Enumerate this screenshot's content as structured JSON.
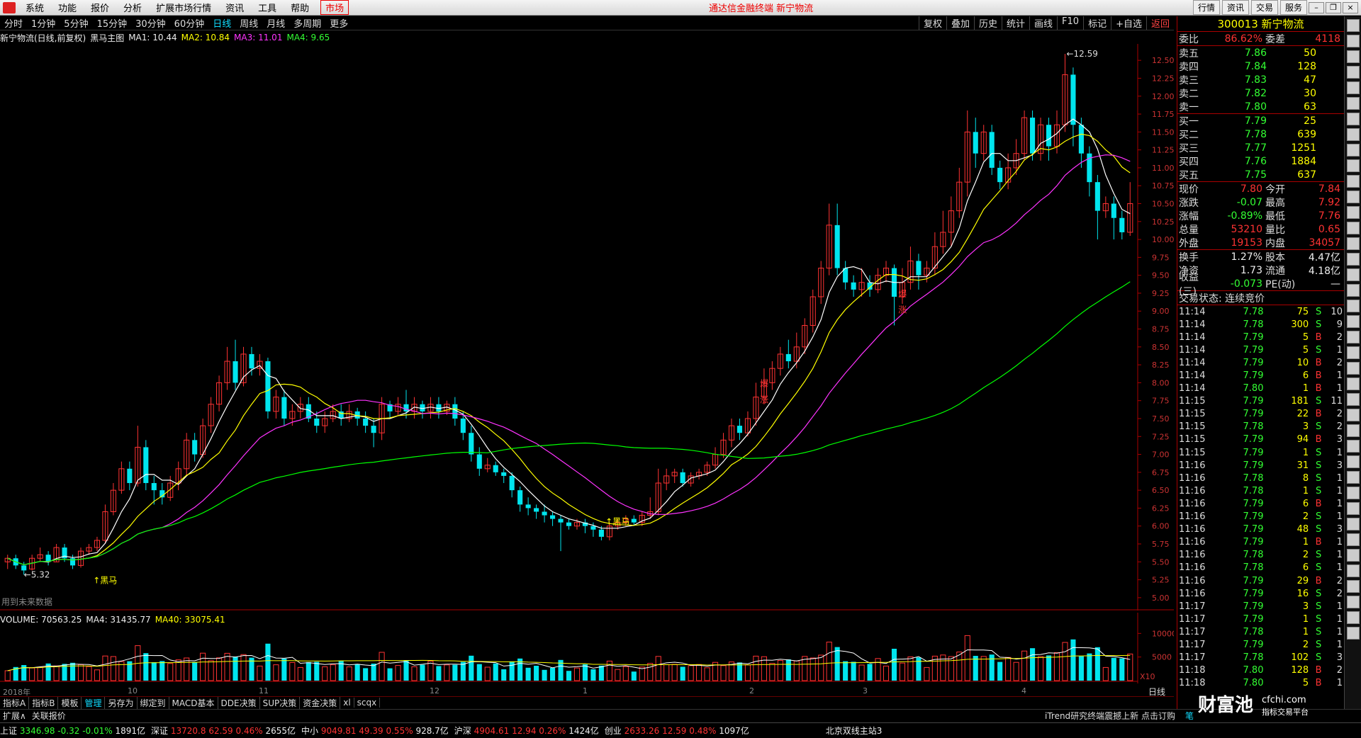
{
  "menu": {
    "items": [
      "系统",
      "功能",
      "报价",
      "分析",
      "扩展市场行情",
      "资讯",
      "工具",
      "帮助"
    ],
    "market": "市场",
    "center_title": "通达信金融终端  新宁物流",
    "right_buttons": [
      "行情",
      "资讯",
      "交易",
      "服务"
    ]
  },
  "periods": {
    "tabs": [
      "分时",
      "1分钟",
      "5分钟",
      "15分钟",
      "30分钟",
      "60分钟",
      "日线",
      "周线",
      "月线",
      "多周期",
      "更多"
    ],
    "active": "日线",
    "tools": [
      "复权",
      "叠加",
      "历史",
      "统计",
      "画线",
      "F10",
      "标记",
      "+自选",
      "返回"
    ]
  },
  "title_row": {
    "stock": "新宁物流(日线,前复权)",
    "indicator": "黑马主图",
    "ma1": "MA1: 10.44",
    "ma2": "MA2: 10.84",
    "ma3": "MA3: 11.01",
    "ma4": "MA4: 9.65"
  },
  "main_labels": {
    "high_label": "12.59",
    "low_label": "5.32",
    "heima1": "黑马",
    "heima2": "黑马",
    "future_data": "用到未来数据",
    "burst1": "爆",
    "burst2": "涨",
    "burst3": "爆",
    "burst4": "涨"
  },
  "colors": {
    "up": "#ff3333",
    "down": "#00e5ee",
    "ma1": "#ffffff",
    "ma2": "#ffff00",
    "ma3": "#ff33ff",
    "ma4": "#00ff00",
    "axis": "#aa0000"
  },
  "volume_row": {
    "volume": "VOLUME: 70563.25",
    "ma4": "MA4: 31435.77",
    "ma40": "MA40: 33075.41"
  },
  "price_axis": [
    "12.50",
    "12.25",
    "12.00",
    "11.75",
    "11.50",
    "11.25",
    "11.00",
    "10.75",
    "10.50",
    "10.25",
    "10.00",
    "9.75",
    "9.50",
    "9.25",
    "9.00",
    "8.75",
    "8.50",
    "8.25",
    "8.00",
    "7.75",
    "7.50",
    "7.25",
    "7.00",
    "6.75",
    "6.50",
    "6.25",
    "6.00",
    "5.75",
    "5.50",
    "5.25",
    "5.00"
  ],
  "vol_axis": [
    "10000",
    "5000",
    "X10"
  ],
  "x_dates": [
    "2018年",
    "10",
    "11",
    "12",
    "1",
    "2",
    "3",
    "4"
  ],
  "chart_data": {
    "type": "candlestick",
    "ylim": [
      5.0,
      12.59
    ],
    "candles": [
      [
        5.5,
        5.55,
        5.4,
        5.6
      ],
      [
        5.55,
        5.45,
        5.4,
        5.6
      ],
      [
        5.45,
        5.38,
        5.32,
        5.5
      ],
      [
        5.4,
        5.55,
        5.38,
        5.6
      ],
      [
        5.55,
        5.6,
        5.5,
        5.7
      ],
      [
        5.6,
        5.5,
        5.45,
        5.65
      ],
      [
        5.5,
        5.7,
        5.5,
        5.75
      ],
      [
        5.7,
        5.55,
        5.5,
        5.75
      ],
      [
        5.55,
        5.45,
        5.4,
        5.6
      ],
      [
        5.45,
        5.65,
        5.42,
        5.7
      ],
      [
        5.65,
        5.7,
        5.6,
        5.75
      ],
      [
        5.7,
        5.8,
        5.65,
        5.85
      ],
      [
        5.8,
        6.2,
        5.75,
        6.3
      ],
      [
        6.2,
        6.5,
        6.15,
        6.6
      ],
      [
        6.5,
        6.8,
        6.45,
        6.9
      ],
      [
        6.8,
        6.6,
        6.5,
        6.9
      ],
      [
        6.6,
        7.1,
        6.55,
        7.4
      ],
      [
        7.1,
        6.6,
        6.5,
        7.2
      ],
      [
        6.6,
        6.5,
        6.3,
        6.7
      ],
      [
        6.5,
        6.4,
        6.3,
        6.6
      ],
      [
        6.4,
        6.6,
        6.35,
        6.7
      ],
      [
        6.6,
        6.8,
        6.5,
        6.9
      ],
      [
        6.8,
        7.2,
        6.7,
        7.3
      ],
      [
        7.2,
        7.0,
        6.9,
        7.3
      ],
      [
        7.0,
        7.4,
        6.95,
        7.5
      ],
      [
        7.4,
        7.7,
        7.3,
        7.8
      ],
      [
        7.7,
        8.0,
        7.6,
        8.1
      ],
      [
        8.0,
        8.3,
        7.9,
        8.5
      ],
      [
        8.3,
        8.0,
        7.9,
        8.6
      ],
      [
        8.0,
        8.4,
        7.95,
        8.5
      ],
      [
        8.4,
        8.2,
        8.1,
        8.5
      ],
      [
        8.2,
        8.3,
        8.1,
        8.4
      ],
      [
        8.3,
        7.6,
        7.5,
        8.35
      ],
      [
        7.6,
        7.8,
        7.5,
        7.9
      ],
      [
        7.8,
        7.5,
        7.4,
        7.9
      ],
      [
        7.5,
        7.6,
        7.4,
        7.7
      ],
      [
        7.6,
        7.7,
        7.5,
        7.8
      ],
      [
        7.7,
        7.5,
        7.45,
        7.8
      ],
      [
        7.5,
        7.4,
        7.3,
        7.6
      ],
      [
        7.4,
        7.5,
        7.3,
        7.6
      ],
      [
        7.5,
        7.6,
        7.45,
        7.7
      ],
      [
        7.6,
        7.5,
        7.4,
        7.7
      ],
      [
        7.5,
        7.6,
        7.45,
        7.7
      ],
      [
        7.6,
        7.5,
        7.4,
        7.65
      ],
      [
        7.5,
        7.4,
        7.3,
        7.6
      ],
      [
        7.4,
        7.3,
        7.1,
        7.5
      ],
      [
        7.3,
        7.7,
        7.2,
        7.8
      ],
      [
        7.7,
        7.6,
        7.5,
        7.75
      ],
      [
        7.6,
        7.7,
        7.55,
        7.8
      ],
      [
        7.7,
        7.6,
        7.5,
        7.9
      ],
      [
        7.6,
        7.7,
        7.5,
        7.8
      ],
      [
        7.7,
        7.6,
        7.5,
        7.75
      ],
      [
        7.6,
        7.7,
        7.5,
        7.8
      ],
      [
        7.7,
        7.6,
        7.5,
        7.8
      ],
      [
        7.6,
        7.7,
        7.55,
        7.75
      ],
      [
        7.7,
        7.5,
        7.4,
        7.8
      ],
      [
        7.5,
        7.3,
        7.2,
        7.6
      ],
      [
        7.3,
        7.0,
        6.9,
        7.4
      ],
      [
        7.0,
        6.8,
        6.7,
        7.1
      ],
      [
        6.8,
        6.85,
        6.75,
        6.95
      ],
      [
        6.85,
        6.75,
        6.7,
        6.9
      ],
      [
        6.75,
        6.7,
        6.6,
        6.8
      ],
      [
        6.7,
        6.5,
        6.4,
        6.75
      ],
      [
        6.5,
        6.3,
        6.2,
        6.55
      ],
      [
        6.3,
        6.25,
        6.15,
        6.4
      ],
      [
        6.25,
        6.2,
        6.1,
        6.3
      ],
      [
        6.2,
        6.15,
        6.05,
        6.3
      ],
      [
        6.15,
        6.1,
        6.0,
        6.2
      ],
      [
        6.1,
        6.05,
        5.65,
        6.15
      ],
      [
        6.05,
        6.0,
        5.95,
        6.1
      ],
      [
        6.0,
        6.05,
        5.95,
        6.1
      ],
      [
        6.05,
        6.0,
        5.9,
        6.1
      ],
      [
        6.0,
        5.95,
        5.85,
        6.05
      ],
      [
        5.95,
        5.85,
        5.8,
        6.0
      ],
      [
        5.85,
        6.0,
        5.8,
        6.05
      ],
      [
        6.0,
        6.05,
        5.95,
        6.1
      ],
      [
        6.05,
        6.1,
        6.0,
        6.15
      ],
      [
        6.1,
        6.05,
        6.0,
        6.15
      ],
      [
        6.05,
        6.15,
        6.0,
        6.2
      ],
      [
        6.15,
        6.2,
        6.1,
        6.4
      ],
      [
        6.2,
        6.6,
        6.15,
        6.8
      ],
      [
        6.6,
        6.7,
        6.5,
        6.8
      ],
      [
        6.7,
        6.75,
        6.6,
        6.8
      ],
      [
        6.75,
        6.6,
        6.55,
        6.8
      ],
      [
        6.6,
        6.7,
        6.55,
        6.75
      ],
      [
        6.7,
        6.75,
        6.65,
        6.8
      ],
      [
        6.75,
        6.85,
        6.7,
        6.9
      ],
      [
        6.85,
        7.0,
        6.8,
        7.1
      ],
      [
        7.0,
        7.2,
        6.95,
        7.3
      ],
      [
        7.2,
        7.4,
        7.1,
        7.5
      ],
      [
        7.4,
        7.3,
        7.2,
        7.5
      ],
      [
        7.3,
        7.5,
        7.25,
        7.6
      ],
      [
        7.5,
        7.8,
        7.4,
        8.0
      ],
      [
        7.8,
        8.0,
        7.7,
        8.2
      ],
      [
        8.0,
        8.2,
        7.9,
        8.3
      ],
      [
        8.2,
        8.4,
        8.1,
        8.5
      ],
      [
        8.4,
        8.3,
        8.2,
        8.6
      ],
      [
        8.3,
        8.5,
        8.2,
        8.7
      ],
      [
        8.5,
        8.8,
        8.4,
        8.9
      ],
      [
        8.8,
        9.2,
        8.7,
        9.3
      ],
      [
        9.2,
        9.6,
        9.1,
        9.7
      ],
      [
        9.6,
        10.2,
        9.5,
        10.5
      ],
      [
        10.2,
        9.6,
        9.5,
        10.5
      ],
      [
        9.6,
        9.4,
        9.3,
        9.7
      ],
      [
        9.4,
        9.3,
        9.2,
        9.5
      ],
      [
        9.3,
        9.4,
        9.2,
        9.6
      ],
      [
        9.4,
        9.3,
        9.2,
        9.5
      ],
      [
        9.3,
        9.5,
        9.25,
        9.6
      ],
      [
        9.5,
        9.6,
        9.4,
        9.7
      ],
      [
        9.6,
        9.2,
        8.8,
        9.65
      ],
      [
        9.2,
        9.4,
        9.1,
        9.6
      ],
      [
        9.4,
        9.7,
        9.3,
        9.9
      ],
      [
        9.7,
        9.5,
        9.3,
        9.8
      ],
      [
        9.5,
        9.6,
        9.4,
        9.7
      ],
      [
        9.6,
        9.9,
        9.5,
        10.1
      ],
      [
        9.9,
        10.1,
        9.8,
        10.4
      ],
      [
        10.1,
        10.4,
        9.9,
        10.6
      ],
      [
        10.4,
        10.8,
        10.3,
        11.0
      ],
      [
        10.8,
        11.5,
        10.6,
        11.8
      ],
      [
        11.5,
        11.2,
        11.0,
        11.7
      ],
      [
        11.2,
        11.5,
        11.1,
        11.6
      ],
      [
        11.5,
        11.0,
        10.9,
        11.6
      ],
      [
        11.0,
        10.8,
        10.7,
        11.1
      ],
      [
        10.8,
        11.0,
        10.7,
        11.2
      ],
      [
        11.0,
        11.2,
        10.9,
        11.4
      ],
      [
        11.2,
        11.7,
        11.1,
        11.8
      ],
      [
        11.7,
        11.2,
        11.1,
        11.8
      ],
      [
        11.2,
        11.6,
        11.1,
        11.7
      ],
      [
        11.6,
        11.3,
        11.1,
        11.7
      ],
      [
        11.3,
        11.6,
        11.2,
        11.8
      ],
      [
        11.6,
        12.3,
        11.5,
        12.59
      ],
      [
        12.3,
        11.6,
        11.3,
        12.4
      ],
      [
        11.6,
        11.2,
        11.0,
        11.7
      ],
      [
        11.2,
        10.8,
        10.6,
        11.3
      ],
      [
        10.8,
        10.4,
        10.0,
        10.9
      ],
      [
        10.4,
        10.5,
        10.3,
        10.6
      ],
      [
        10.5,
        10.3,
        10.0,
        10.6
      ],
      [
        10.3,
        10.1,
        10.0,
        10.4
      ],
      [
        10.1,
        10.5,
        10.05,
        10.8
      ]
    ],
    "volume_ylim": [
      0,
      12000
    ]
  },
  "quote": {
    "code_name": "300013 新宁物流",
    "weibi_label": "委比",
    "weibi": "86.62%",
    "weicha_label": "委差",
    "weicha": "4118",
    "asks": [
      [
        "卖五",
        "7.86",
        "50"
      ],
      [
        "卖四",
        "7.84",
        "128"
      ],
      [
        "卖三",
        "7.83",
        "47"
      ],
      [
        "卖二",
        "7.82",
        "30"
      ],
      [
        "卖一",
        "7.80",
        "63"
      ]
    ],
    "bids": [
      [
        "买一",
        "7.79",
        "25"
      ],
      [
        "买二",
        "7.78",
        "639"
      ],
      [
        "买三",
        "7.77",
        "1251"
      ],
      [
        "买四",
        "7.76",
        "1884"
      ],
      [
        "买五",
        "7.75",
        "637"
      ]
    ],
    "stats": [
      [
        "现价",
        "7.80",
        "今开",
        "7.84"
      ],
      [
        "涨跌",
        "-0.07",
        "最高",
        "7.92"
      ],
      [
        "涨幅",
        "-0.89%",
        "最低",
        "7.76"
      ],
      [
        "总量",
        "53210",
        "量比",
        "0.65"
      ],
      [
        "外盘",
        "19153",
        "内盘",
        "34057"
      ]
    ],
    "stats2": [
      [
        "换手",
        "1.27%",
        "股本",
        "4.47亿"
      ],
      [
        "净资",
        "1.73",
        "流通",
        "4.18亿"
      ],
      [
        "收益(三)",
        "-0.073",
        "PE(动)",
        "—"
      ]
    ],
    "trade_status": "交易状态: 连续竞价"
  },
  "ticks": [
    [
      "11:14",
      "7.78",
      "75",
      "S",
      "10"
    ],
    [
      "11:14",
      "7.78",
      "300",
      "S",
      "9"
    ],
    [
      "11:14",
      "7.79",
      "5",
      "B",
      "2"
    ],
    [
      "11:14",
      "7.79",
      "5",
      "S",
      "1"
    ],
    [
      "11:14",
      "7.79",
      "10",
      "B",
      "2"
    ],
    [
      "11:14",
      "7.79",
      "6",
      "B",
      "1"
    ],
    [
      "11:14",
      "7.80",
      "1",
      "B",
      "1"
    ],
    [
      "11:15",
      "7.79",
      "181",
      "S",
      "11"
    ],
    [
      "11:15",
      "7.79",
      "22",
      "B",
      "2"
    ],
    [
      "11:15",
      "7.78",
      "3",
      "S",
      "2"
    ],
    [
      "11:15",
      "7.79",
      "94",
      "B",
      "3"
    ],
    [
      "11:15",
      "7.79",
      "1",
      "S",
      "1"
    ],
    [
      "11:16",
      "7.79",
      "31",
      "S",
      "3"
    ],
    [
      "11:16",
      "7.78",
      "8",
      "S",
      "1"
    ],
    [
      "11:16",
      "7.78",
      "1",
      "S",
      "1"
    ],
    [
      "11:16",
      "7.79",
      "6",
      "B",
      "1"
    ],
    [
      "11:16",
      "7.79",
      "2",
      "S",
      "1"
    ],
    [
      "11:16",
      "7.79",
      "48",
      "S",
      "3"
    ],
    [
      "11:16",
      "7.79",
      "1",
      "B",
      "1"
    ],
    [
      "11:16",
      "7.78",
      "2",
      "S",
      "1"
    ],
    [
      "11:16",
      "7.78",
      "6",
      "S",
      "1"
    ],
    [
      "11:16",
      "7.79",
      "29",
      "B",
      "2"
    ],
    [
      "11:16",
      "7.79",
      "16",
      "S",
      "2"
    ],
    [
      "11:17",
      "7.79",
      "3",
      "S",
      "1"
    ],
    [
      "11:17",
      "7.79",
      "1",
      "S",
      "1"
    ],
    [
      "11:17",
      "7.78",
      "1",
      "S",
      "1"
    ],
    [
      "11:17",
      "7.79",
      "2",
      "S",
      "1"
    ],
    [
      "11:17",
      "7.78",
      "102",
      "S",
      "3"
    ],
    [
      "11:18",
      "7.80",
      "128",
      "B",
      "2"
    ],
    [
      "11:18",
      "7.80",
      "5",
      "B",
      "1"
    ]
  ],
  "bottom_tabs": [
    "指标A",
    "指标B",
    "模板",
    "管理",
    "另存为",
    "绑定到",
    "MACD基本",
    "DDE决策",
    "SUP决策",
    "资金决策",
    "xl",
    "scqx"
  ],
  "bottom_tab_active": "管理",
  "day_label": "日线",
  "ext_bar": {
    "ext": "扩展∧",
    "related": "关联报价",
    "notice": "iTrend研究终端震撼上新 点击订购",
    "pen": "笔"
  },
  "status": [
    {
      "name": "上证",
      "price": "3346.98",
      "chg": "-0.32",
      "pct": "-0.01%",
      "amt": "1891亿"
    },
    {
      "name": "深证",
      "price": "13720.8",
      "chg": "62.59",
      "pct": "0.46%",
      "amt": "2655亿"
    },
    {
      "name": "中小",
      "price": "9049.81",
      "chg": "49.39",
      "pct": "0.55%",
      "amt": "928.7亿"
    },
    {
      "name": "沪深",
      "price": "4904.61",
      "chg": "12.94",
      "pct": "0.26%",
      "amt": "1424亿"
    },
    {
      "name": "创业",
      "price": "2633.26",
      "chg": "12.59",
      "pct": "0.48%",
      "amt": "1097亿"
    }
  ],
  "station": "北京双线主站3",
  "watermark": {
    "main": "财富池",
    "site": "cfchi.com",
    "sub": "指标交易平台"
  }
}
